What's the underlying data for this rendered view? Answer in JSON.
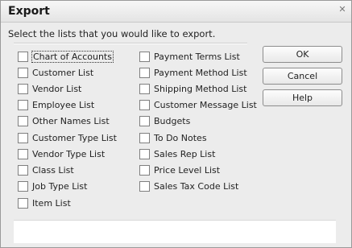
{
  "dialog": {
    "title": "Export",
    "close_glyph": "✕",
    "prompt": "Select the lists that you would like to export."
  },
  "left_column": [
    "Chart of Accounts",
    "Customer List",
    "Vendor List",
    "Employee List",
    "Other Names List",
    "Customer Type List",
    "Vendor Type List",
    "Class List",
    "Job Type List",
    "Item List"
  ],
  "right_column": [
    "Payment Terms List",
    "Payment Method List",
    "Shipping Method List",
    "Customer Message List",
    "Budgets",
    "To Do Notes",
    "Sales Rep List",
    "Price Level List",
    "Sales Tax Code List"
  ],
  "buttons": {
    "ok": "OK",
    "cancel": "Cancel",
    "help": "Help"
  }
}
